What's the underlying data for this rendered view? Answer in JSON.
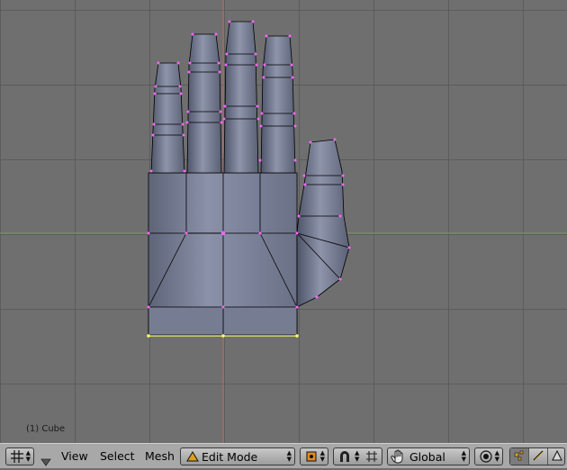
{
  "viewport": {
    "object_label": "(1) Cube",
    "colors": {
      "background": "#6f6f6f",
      "grid": "#5a5a5a",
      "x_axis": "#7a9a6a",
      "y_axis": "#b8686a",
      "mesh_fill": "#6d7388",
      "edge": "#000000",
      "selected_edge": "#ffff66",
      "vertex": "#ff66ff"
    }
  },
  "header": {
    "editor_type_icon": "grid-editor-icon",
    "collapse_icon": "triangle-down-icon",
    "menus": {
      "view": "View",
      "select": "Select",
      "mesh": "Mesh"
    },
    "mode": {
      "icon": "edit-mode-triangle-icon",
      "value": "Edit Mode"
    },
    "pivot_icon": "pivot-point-icon",
    "snap_icon": "magnet-icon",
    "proportional_icon": "proportional-edit-icon",
    "manipulator_icon": "hand-manipulator-icon",
    "orientation": {
      "value": "Global"
    },
    "layer_icon": "target-circle-icon",
    "select_modes": [
      "vertex-select-icon",
      "edge-select-icon",
      "face-select-icon"
    ]
  }
}
